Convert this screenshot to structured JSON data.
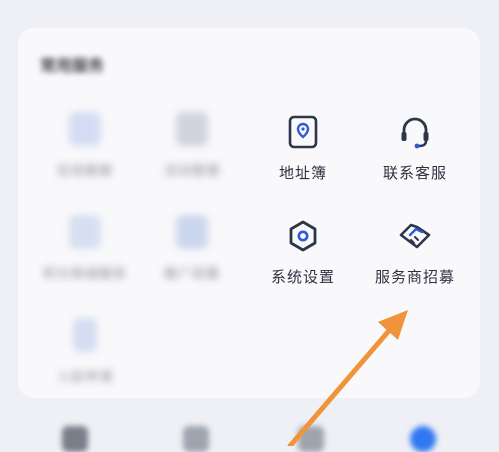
{
  "section": {
    "title": "常用服务"
  },
  "services": [
    {
      "label": "地址簿",
      "icon": "address-book-icon"
    },
    {
      "label": "联系客服",
      "icon": "headset-icon"
    },
    {
      "label": "系统设置",
      "icon": "settings-icon"
    },
    {
      "label": "服务商招募",
      "icon": "handshake-icon"
    }
  ],
  "blurred_services": [
    {
      "label": "在线客服"
    },
    {
      "label": "活动管理"
    },
    {
      "label": "积分商城服务"
    },
    {
      "label": "推广招募"
    },
    {
      "label": "入驻申请"
    }
  ],
  "colors": {
    "accent": "#2b5bd7",
    "icon_dark": "#2d3548",
    "arrow": "#f0933b",
    "card_bg": "#f9f9fb",
    "page_bg": "#eef0f5"
  }
}
